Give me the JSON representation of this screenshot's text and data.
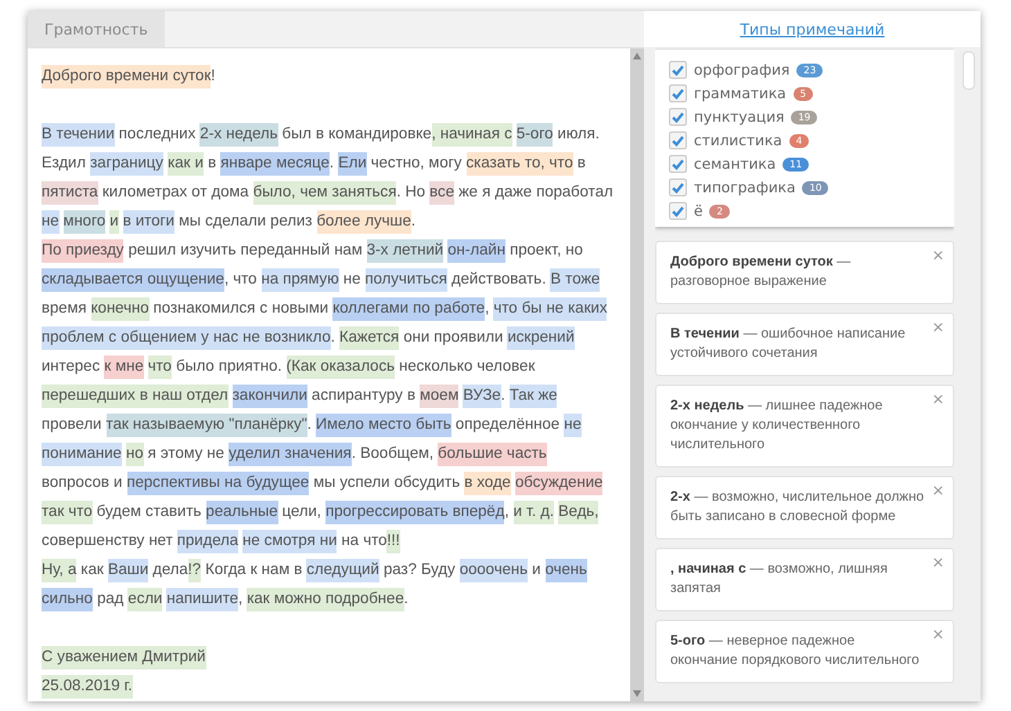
{
  "tab": {
    "label": "Грамотность",
    "selected": true
  },
  "document": {
    "blocks": [
      {
        "lines": [
          [
            {
              "text": "Доброго времени суток",
              "color": "#fde4cd"
            },
            {
              "text": "!"
            }
          ]
        ]
      },
      {
        "lines": [
          [
            {
              "text": "В течении",
              "color": "#cfe0f6"
            },
            {
              "text": " последних "
            },
            {
              "text": "2-х недель",
              "color": "#c9dde2"
            },
            {
              "text": " был в командировке"
            },
            {
              "text": ", начиная с ",
              "color": "#dfecd6"
            },
            {
              "text": "5-ого",
              "color": "#c9dde2"
            },
            {
              "text": " июля."
            }
          ],
          [
            {
              "text": "Ездил "
            },
            {
              "text": "заграницу ",
              "color": "#cfe0f6"
            },
            {
              "text": "как и",
              "color": "#dfecd6"
            },
            {
              "text": " в "
            },
            {
              "text": "январе месяце",
              "color": "#b9d0f3"
            },
            {
              "text": ". "
            },
            {
              "text": "Ели",
              "color": "#b9d0f3"
            },
            {
              "text": " честно, могу "
            },
            {
              "text": "сказать то, что",
              "color": "#fde4cd"
            },
            {
              "text": " в"
            }
          ],
          [
            {
              "text": "пятиста",
              "color": "#eed8d8"
            },
            {
              "text": " километрах от дома "
            },
            {
              "text": "было, чем заняться",
              "color": "#dfecd6"
            },
            {
              "text": ". Но "
            },
            {
              "text": "все",
              "color": "#eed8d8"
            },
            {
              "text": " же я даже поработал"
            }
          ],
          [
            {
              "text": "не ",
              "color": "#cfe0f6"
            },
            {
              "text": "много ",
              "color": "#c9dde2"
            },
            {
              "text": "и ",
              "color": "#dfecd6"
            },
            {
              "text": "в итоги",
              "color": "#cfe0f6"
            },
            {
              "text": " мы сделали релиз "
            },
            {
              "text": "более лучше",
              "color": "#fde4cd"
            },
            {
              "text": "."
            }
          ],
          [
            {
              "text": "По приезду",
              "color": "#f6cfcf"
            },
            {
              "text": " решил изучить переданный нам "
            },
            {
              "text": "3-х летний ",
              "color": "#c9dde2"
            },
            {
              "text": "он-лайн",
              "color": "#b9d0f3"
            },
            {
              "text": " проект, но"
            }
          ],
          [
            {
              "text": "складывается ощущение",
              "color": "#b9d0f3"
            },
            {
              "text": ", что "
            },
            {
              "text": "на прямую",
              "color": "#cfe0f6"
            },
            {
              "text": " не "
            },
            {
              "text": "получиться",
              "color": "#cfe0f6"
            },
            {
              "text": " действовать. "
            },
            {
              "text": "В тоже",
              "color": "#cfe0f6"
            }
          ],
          [
            {
              "text": "время "
            },
            {
              "text": "конечно",
              "color": "#dfecd6"
            },
            {
              "text": " познакомился с новыми "
            },
            {
              "text": "коллегами по работе",
              "color": "#b9d0f3"
            },
            {
              "text": ", "
            },
            {
              "text": "что бы не каких",
              "color": "#cfe0f6"
            }
          ],
          [
            {
              "text": "проблем с общением у нас не возникло",
              "color": "#cfe0f6"
            },
            {
              "text": ". "
            },
            {
              "text": "Кажется",
              "color": "#dfecd6"
            },
            {
              "text": " они проявили "
            },
            {
              "text": "искрений",
              "color": "#cfe0f6"
            }
          ],
          [
            {
              "text": "интерес "
            },
            {
              "text": "к мне ",
              "color": "#f6cfcf"
            },
            {
              "text": "что",
              "color": "#dfecd6"
            },
            {
              "text": " было приятно. "
            },
            {
              "text": "(Как оказалось",
              "color": "#dfecd6"
            },
            {
              "text": " несколько человек"
            }
          ],
          [
            {
              "text": "перешедших в наш отдел ",
              "color": "#dfecd6"
            },
            {
              "text": "закончили",
              "color": "#b9d0f3"
            },
            {
              "text": " аспирантуру в "
            },
            {
              "text": "моем ",
              "color": "#eed8d8"
            },
            {
              "text": "ВУЗе",
              "color": "#cfe0f6"
            },
            {
              "text": ". "
            },
            {
              "text": "Так же",
              "color": "#cfe0f6"
            }
          ],
          [
            {
              "text": "провели "
            },
            {
              "text": "так называемую \"планёрку\"",
              "color": "#c9dde2"
            },
            {
              "text": ". "
            },
            {
              "text": "Имело место быть",
              "color": "#b9d0f3"
            },
            {
              "text": " определённое "
            },
            {
              "text": "не",
              "color": "#cfe0f6"
            }
          ],
          [
            {
              "text": "понимание ",
              "color": "#cfe0f6"
            },
            {
              "text": "но",
              "color": "#dfecd6"
            },
            {
              "text": " я этому не "
            },
            {
              "text": "уделил значения",
              "color": "#b9d0f3"
            },
            {
              "text": ". Вообщем, "
            },
            {
              "text": "большие часть",
              "color": "#f6cfcf"
            }
          ],
          [
            {
              "text": "вопросов и "
            },
            {
              "text": "перспективы на будущее",
              "color": "#b9d0f3"
            },
            {
              "text": " мы успели обсудить "
            },
            {
              "text": "в ходе ",
              "color": "#fde4cd"
            },
            {
              "text": "обсуждение",
              "color": "#f6cfcf"
            }
          ],
          [
            {
              "text": "так что",
              "color": "#dfecd6"
            },
            {
              "text": " будем ставить "
            },
            {
              "text": "реальные",
              "color": "#b9d0f3"
            },
            {
              "text": " цели, "
            },
            {
              "text": "прогрессировать вперёд",
              "color": "#b9d0f3"
            },
            {
              "text": ", "
            },
            {
              "text": "и т. д. ",
              "color": "#dfecd6"
            },
            {
              "text": "Ведь,",
              "color": "#dfecd6"
            }
          ],
          [
            {
              "text": "совершенству нет "
            },
            {
              "text": "придела ",
              "color": "#cfe0f6"
            },
            {
              "text": "не смотря ни",
              "color": "#cfe0f6"
            },
            {
              "text": " на что"
            },
            {
              "text": "!!!",
              "color": "#dfecd6"
            }
          ],
          [
            {
              "text": "Ну, а",
              "color": "#dfecd6"
            },
            {
              "text": " как "
            },
            {
              "text": "Ваши",
              "color": "#cfe0f6"
            },
            {
              "text": " дела"
            },
            {
              "text": "!?",
              "color": "#dfecd6"
            },
            {
              "text": " Когда к нам в "
            },
            {
              "text": "следущий",
              "color": "#cfe0f6"
            },
            {
              "text": " раз? Буду "
            },
            {
              "text": "оооочень",
              "color": "#cfe0f6"
            },
            {
              "text": " и "
            },
            {
              "text": "очень",
              "color": "#b9d0f3"
            }
          ],
          [
            {
              "text": "сильно",
              "color": "#b9d0f3"
            },
            {
              "text": " рад "
            },
            {
              "text": "если ",
              "color": "#dfecd6"
            },
            {
              "text": "напишите",
              "color": "#cfe0f6"
            },
            {
              "text": ", "
            },
            {
              "text": "как можно подробнее",
              "color": "#dfecd6"
            },
            {
              "text": "."
            }
          ]
        ]
      },
      {
        "lines": [
          [
            {
              "text": "С уважением Дмитрий",
              "color": "#dfecd6"
            }
          ],
          [
            {
              "text": "25.08.2019 г.",
              "color": "#dfecd6"
            }
          ]
        ]
      }
    ]
  },
  "sidebar": {
    "title": "Типы примечаний",
    "filters": [
      {
        "label": "орфография",
        "count": "23",
        "checked": true,
        "color": "#5b9bd5"
      },
      {
        "label": "грамматика",
        "count": "5",
        "checked": true,
        "color": "#d9826f"
      },
      {
        "label": "пунктуация",
        "count": "19",
        "checked": true,
        "color": "#a8a29a"
      },
      {
        "label": "стилистика",
        "count": "4",
        "checked": true,
        "color": "#e0806c"
      },
      {
        "label": "семантика",
        "count": "11",
        "checked": true,
        "color": "#4a90d9"
      },
      {
        "label": "типографика",
        "count": "10",
        "checked": true,
        "color": "#7f95b5"
      },
      {
        "label": "ё",
        "count": "2",
        "checked": true,
        "color": "#d48a80"
      }
    ],
    "notes": [
      {
        "text": "**Доброго времени суток** — разговорное выражение",
        "close": "×"
      },
      {
        "text": "**В течении** — ошибочное написание устойчивого сочетания",
        "close": "×"
      },
      {
        "text": "**2-х недель** — лишнее падежное окончание у количественного числительного",
        "close": "×"
      },
      {
        "text": "**2-х** — возможно, числительное должно быть записано в словесной форме",
        "close": "×"
      },
      {
        "text": "**, начиная с** — возможно, лишняя запятая",
        "close": "×"
      },
      {
        "text": "**5-ого** — неверное падежное окончание порядкового числительного",
        "close": "×"
      }
    ]
  }
}
